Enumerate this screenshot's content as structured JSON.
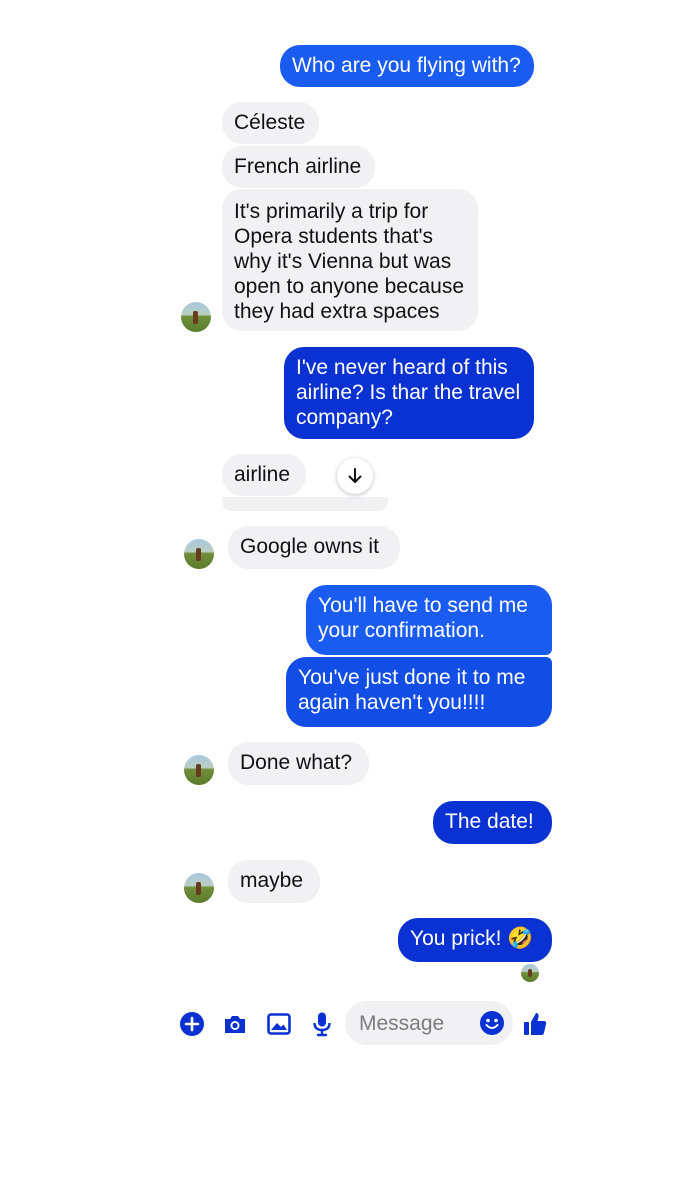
{
  "messages": [
    {
      "id": "m1",
      "dir": "out",
      "text": "Who are you flying with?"
    },
    {
      "id": "m2",
      "dir": "in",
      "text": "Céleste"
    },
    {
      "id": "m3",
      "dir": "in",
      "text": "French airline"
    },
    {
      "id": "m4",
      "dir": "in",
      "text": "It's primarily a trip for Opera students that's why it's Vienna but was open to anyone because they had extra spaces"
    },
    {
      "id": "m5",
      "dir": "out",
      "text": "I've never heard of this airline? Is thar the travel company?"
    },
    {
      "id": "m6",
      "dir": "in",
      "text": "airline"
    },
    {
      "id": "m7",
      "dir": "in",
      "text": "Google owns it"
    },
    {
      "id": "m8",
      "dir": "out",
      "text": "You'll have to send me your confirmation."
    },
    {
      "id": "m9",
      "dir": "out",
      "text": "You've just done it to me again haven't you!!!!"
    },
    {
      "id": "m10",
      "dir": "in",
      "text": "Done what?"
    },
    {
      "id": "m11",
      "dir": "out",
      "text": "The date!"
    },
    {
      "id": "m12",
      "dir": "in",
      "text": "maybe"
    },
    {
      "id": "m13",
      "dir": "out",
      "text": "You prick! 🤣"
    }
  ],
  "composer": {
    "placeholder": "Message",
    "icons": [
      "plus-circle-icon",
      "camera-icon",
      "image-icon",
      "microphone-icon",
      "emoji-icon",
      "thumbs-up-icon"
    ]
  },
  "colors": {
    "outgoing_light": "#1b5cf0",
    "outgoing_dark": "#0a32d2",
    "incoming": "#f1f1f4",
    "accent": "#0a32d2"
  }
}
